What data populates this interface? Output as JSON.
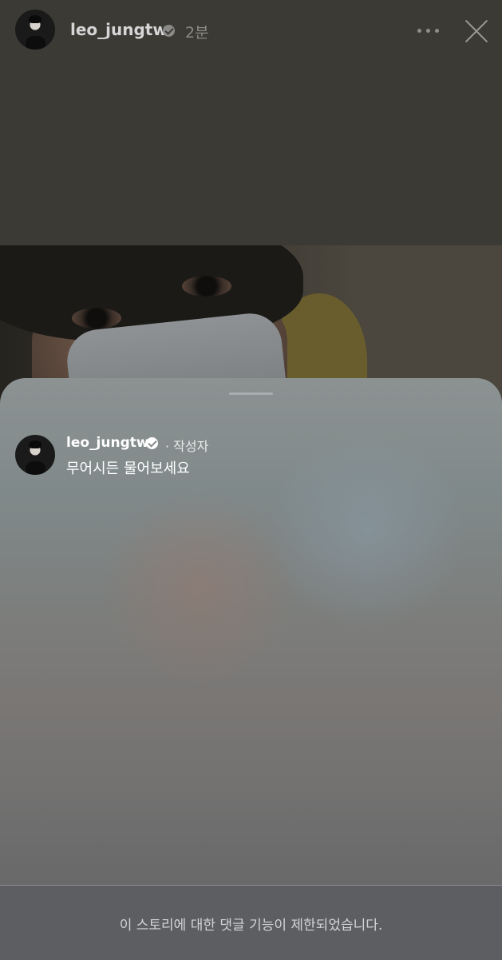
{
  "story": {
    "username": "leo_jungtw",
    "verified": true,
    "time_ago": "2분",
    "icons": {
      "verified": "verified-badge-icon",
      "more": "more-options-icon",
      "close": "close-icon"
    }
  },
  "comments_sheet": {
    "comment": {
      "username": "leo_jungtw",
      "author_badge": "· 작성자",
      "text": "무어시든 물어보세요"
    },
    "footer_notice": "이 스토리에 대한 댓글 기능이 제한되었습니다."
  }
}
